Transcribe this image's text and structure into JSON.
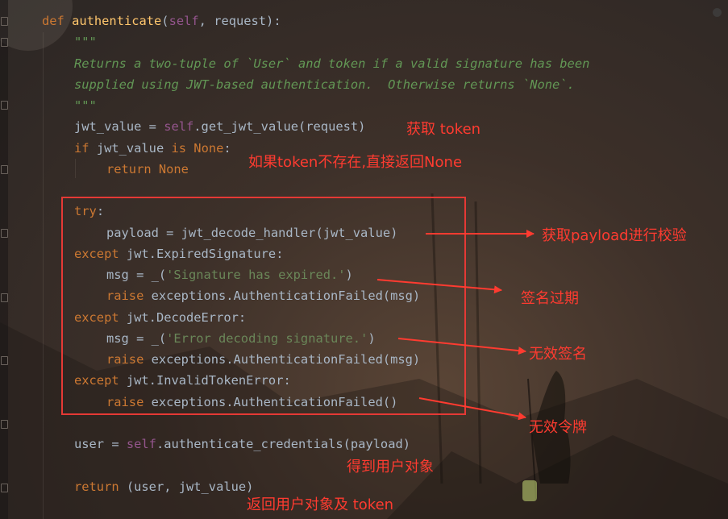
{
  "code": {
    "def_kw": "def",
    "fn_name": "authenticate",
    "open_paren": "(",
    "self_kw": "self",
    "params_rest": ", request):",
    "doc_open": "\"\"\"",
    "doc_line1": "Returns a two-tuple of `User` and token if a valid signature has been",
    "doc_line2": "supplied using JWT-based authentication.  Otherwise returns `None`.",
    "doc_close": "\"\"\"",
    "l5_a": "jwt_value = ",
    "l5_self": "self",
    "l5_b": ".get_jwt_value(request)",
    "l6_if": "if",
    "l6_a": " jwt_value ",
    "l6_is": "is",
    "l6_none": " None",
    "l6_colon": ":",
    "l7_return": "return",
    "l7_none": " None",
    "l9_try": "try",
    "l9_colon": ":",
    "l10": "payload = jwt_decode_handler(jwt_value)",
    "l11_except": "except",
    "l11_rest": " jwt.ExpiredSignature:",
    "l12_a": "msg = _(",
    "l12_str": "'Signature has expired.'",
    "l12_b": ")",
    "l13_raise": "raise",
    "l13_rest": " exceptions.AuthenticationFailed(msg)",
    "l14_except": "except",
    "l14_rest": " jwt.DecodeError:",
    "l15_a": "msg = _(",
    "l15_str": "'Error decoding signature.'",
    "l15_b": ")",
    "l16_raise": "raise",
    "l16_rest": " exceptions.AuthenticationFailed(msg)",
    "l17_except": "except",
    "l17_rest": " jwt.InvalidTokenError:",
    "l18_raise": "raise",
    "l18_rest": " exceptions.AuthenticationFailed()",
    "l20_a": "user = ",
    "l20_self": "self",
    "l20_b": ".authenticate_credentials(payload)",
    "l22_return": "return",
    "l22_rest": " (user, jwt_value)"
  },
  "annotations": {
    "get_token": "获取 token",
    "token_missing": "如果token不存在,直接返回None",
    "validate_payload": "获取payload进行校验",
    "signature_expired": "签名过期",
    "invalid_signature": "无效签名",
    "invalid_token": "无效令牌",
    "get_user": "得到用户对象",
    "return_user_token": "返回用户对象及 token"
  },
  "colors": {
    "keyword": "#cc7832",
    "function": "#ffc66d",
    "self": "#94558d",
    "docstring": "#629755",
    "string": "#6a8759",
    "identifier": "#a9b7c6",
    "annotation": "#ff3b30"
  }
}
